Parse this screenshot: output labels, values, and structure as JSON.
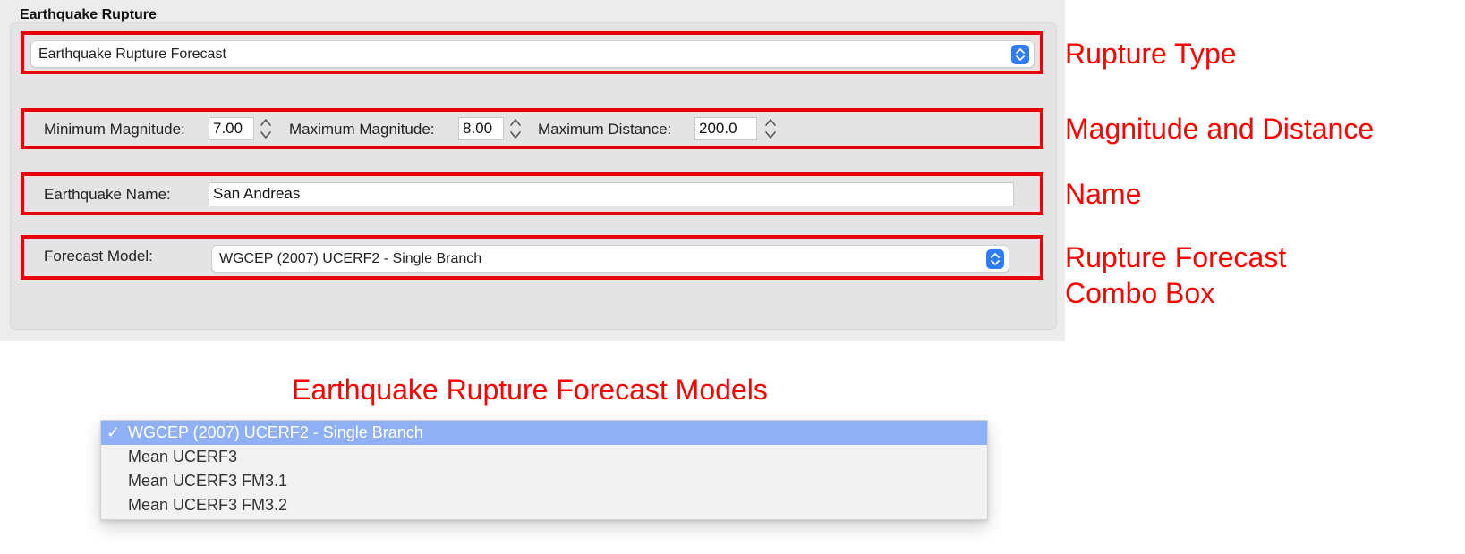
{
  "panel": {
    "title": "Earthquake Rupture",
    "rupture_type": {
      "selected": "Earthquake Rupture Forecast"
    },
    "magnitude": {
      "min_label": "Minimum Magnitude:",
      "min_value": "7.00",
      "max_label": "Maximum Magnitude:",
      "max_value": "8.00",
      "dist_label": "Maximum Distance:",
      "dist_value": "200.0"
    },
    "name": {
      "label": "Earthquake Name:",
      "value": "San Andreas"
    },
    "forecast": {
      "label": "Forecast Model:",
      "selected": "WGCEP (2007) UCERF2 - Single Branch"
    }
  },
  "annotations": {
    "rupture_type": "Rupture Type",
    "magnitude_distance": "Magnitude and Distance",
    "name": "Name",
    "combo_line1": "Rupture Forecast",
    "combo_line2": "Combo Box",
    "models_title": "Earthquake Rupture Forecast Models"
  },
  "dropdown": {
    "check": "✓",
    "items": [
      "WGCEP (2007) UCERF2 - Single Branch",
      "Mean UCERF3",
      "Mean UCERF3 FM3.1",
      "Mean UCERF3 FM3.2"
    ]
  },
  "colors": {
    "highlight": "#e8000b",
    "annotation": "#ff0000",
    "selection": "#8fb0f4",
    "combo_button": "#2f7df6"
  }
}
